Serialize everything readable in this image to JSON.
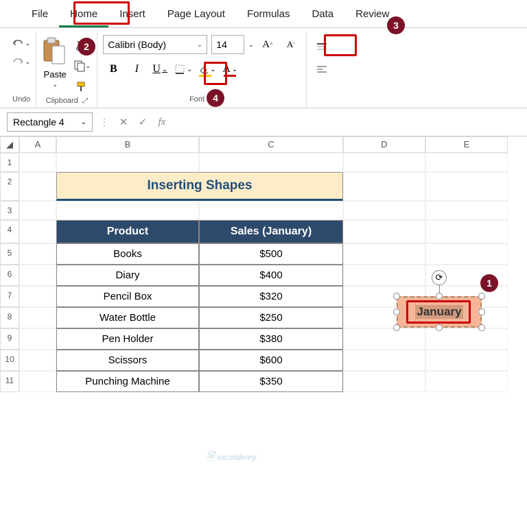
{
  "tabs": {
    "file": "File",
    "home": "Home",
    "insert": "Insert",
    "pagelayout": "Page Layout",
    "formulas": "Formulas",
    "data": "Data",
    "review": "Review"
  },
  "ribbon": {
    "undo_label": "Undo",
    "clipboard_label": "Clipboard",
    "paste_label": "Paste",
    "font_label": "Font",
    "font_name": "Calibri (Body)",
    "font_size": "14"
  },
  "namebox": "Rectangle 4",
  "columns": [
    "A",
    "B",
    "C",
    "D",
    "E"
  ],
  "rows": [
    "1",
    "2",
    "3",
    "4",
    "5",
    "6",
    "7",
    "8",
    "9",
    "10",
    "11"
  ],
  "sheet_title": "Inserting Shapes",
  "table": {
    "headers": [
      "Product",
      "Sales (January)"
    ],
    "rows": [
      [
        "Books",
        "$500"
      ],
      [
        "Diary",
        "$400"
      ],
      [
        "Pencil Box",
        "$320"
      ],
      [
        "Water Bottle",
        "$250"
      ],
      [
        "Pen Holder",
        "$380"
      ],
      [
        "Scissors",
        "$600"
      ],
      [
        "Punching Machine",
        "$350"
      ]
    ]
  },
  "shape_text": "January",
  "badges": {
    "b1": "1",
    "b2": "2",
    "b3": "3",
    "b4": "4"
  },
  "watermark": "exceldemy",
  "chart_data": {
    "type": "table",
    "title": "Inserting Shapes",
    "columns": [
      "Product",
      "Sales (January)"
    ],
    "rows": [
      [
        "Books",
        500
      ],
      [
        "Diary",
        400
      ],
      [
        "Pencil Box",
        320
      ],
      [
        "Water Bottle",
        250
      ],
      [
        "Pen Holder",
        380
      ],
      [
        "Scissors",
        600
      ],
      [
        "Punching Machine",
        350
      ]
    ],
    "currency": "$"
  }
}
